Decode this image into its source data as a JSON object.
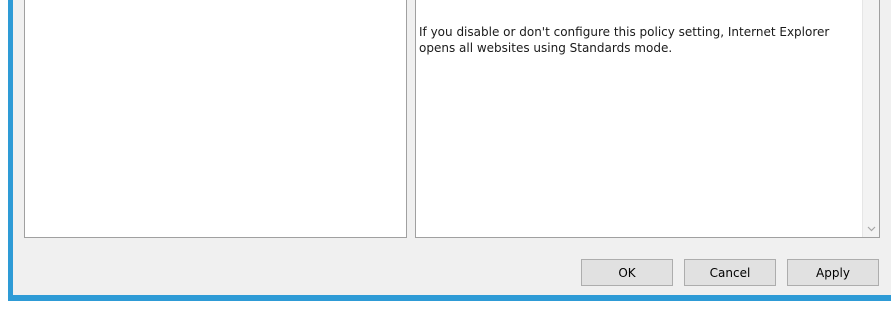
{
  "help": {
    "text": "If you disable or don't configure this policy setting, Internet Explorer opens all websites using Standards mode."
  },
  "buttons": {
    "ok_label": "OK",
    "cancel_label": "Cancel",
    "apply_label": "Apply"
  },
  "colors": {
    "window_frame": "#2e9bd6",
    "dialog_background": "#f0f0f0",
    "button_face": "#e1e1e1",
    "button_border": "#adadad"
  },
  "icons": {
    "scroll_down": "chevron-down-icon"
  }
}
